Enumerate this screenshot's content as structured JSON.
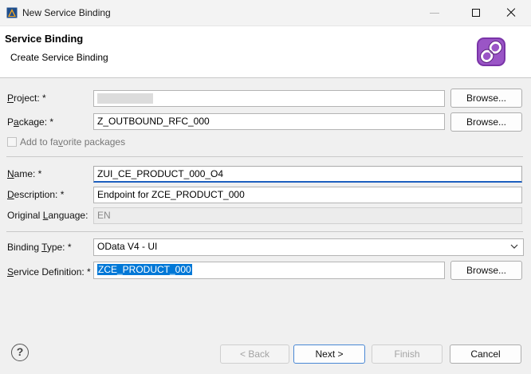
{
  "window": {
    "title": "New Service Binding"
  },
  "header": {
    "title": "Service Binding",
    "subtitle": "Create Service Binding",
    "icon": "service-binding-chain-icon"
  },
  "form": {
    "project": {
      "label_pre": "",
      "label_u": "P",
      "label_post": "roject: *",
      "value": "",
      "browse": "Browse..."
    },
    "package": {
      "label_pre": "P",
      "label_u": "a",
      "label_post": "ckage: *",
      "value": "Z_OUTBOUND_RFC_000",
      "browse": "Browse..."
    },
    "favorite": {
      "label_pre": "Add to fa",
      "label_u": "v",
      "label_post": "orite packages",
      "checked": false
    },
    "name": {
      "label_pre": "",
      "label_u": "N",
      "label_post": "ame: *",
      "value": "ZUI_CE_PRODUCT_000_O4"
    },
    "description": {
      "label_pre": "",
      "label_u": "D",
      "label_post": "escription: *",
      "value": "Endpoint for ZCE_PRODUCT_000"
    },
    "original_language": {
      "label_pre": "Original ",
      "label_u": "L",
      "label_post": "anguage:",
      "value": "EN"
    },
    "binding_type": {
      "label_pre": "Binding ",
      "label_u": "T",
      "label_post": "ype: *",
      "value": "OData V4 - UI"
    },
    "service_definition": {
      "label_pre": "",
      "label_u": "S",
      "label_post": "ervice Definition: *",
      "value": "ZCE_PRODUCT_000",
      "browse": "Browse..."
    }
  },
  "footer": {
    "help": "?",
    "back": "< Back",
    "next": "Next >",
    "finish": "Finish",
    "cancel": "Cancel"
  },
  "colors": {
    "accent": "#1d5fbf",
    "selection": "#0078d7",
    "icon_purple": "#8a3fb5"
  }
}
